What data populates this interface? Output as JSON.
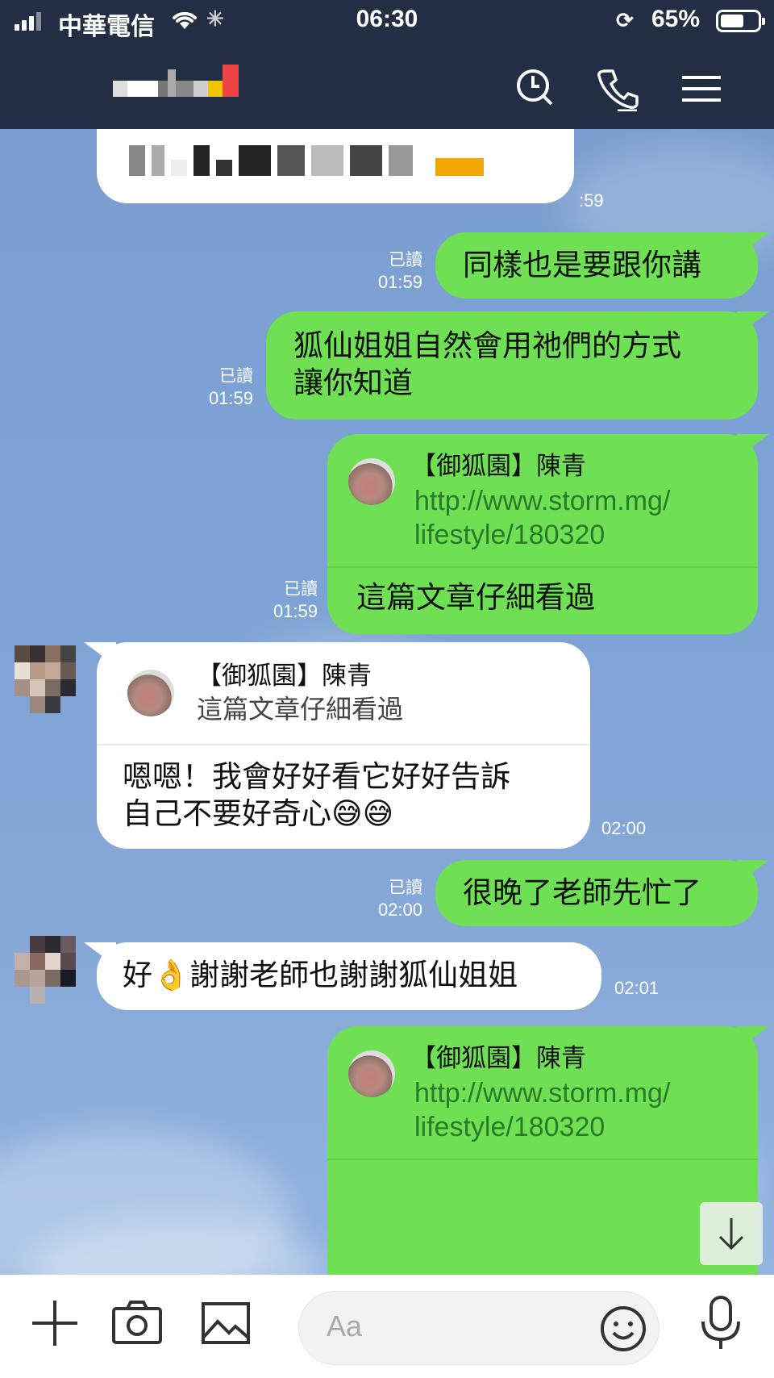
{
  "status_bar": {
    "carrier": "中華電信",
    "time": "06:30",
    "battery": "65%",
    "battery_level": 0.65
  },
  "header": {
    "icons": [
      "search-icon",
      "phone-icon",
      "menu-icon"
    ]
  },
  "messages": [
    {
      "id": "m0",
      "side": "left",
      "text": "",
      "time": ":59"
    },
    {
      "id": "m1",
      "side": "right",
      "read": "已讀",
      "time": "01:59",
      "text": "同樣也是要跟你講"
    },
    {
      "id": "m2",
      "side": "right",
      "read": "已讀",
      "time": "01:59",
      "lines": [
        "狐仙姐姐自然會用祂們的方式",
        "讓你知道"
      ]
    },
    {
      "id": "m3",
      "side": "right",
      "read": "已讀",
      "time": "01:59",
      "preview_title": "【御狐園】陳青",
      "preview_link": [
        "http://www.storm.mg/",
        "lifestyle/180320"
      ],
      "text": "這篇文章仔細看過"
    },
    {
      "id": "m4",
      "side": "left",
      "time": "02:00",
      "quote_title": "【御狐園】陳青",
      "quote_text": "這篇文章仔細看過",
      "lines": [
        "嗯嗯！我會好好看它好好告訴",
        "自己不要好奇心"
      ],
      "emoji": [
        "😅",
        "😅"
      ]
    },
    {
      "id": "m5",
      "side": "right",
      "read": "已讀",
      "time": "02:00",
      "text": "很晚了老師先忙了"
    },
    {
      "id": "m6",
      "side": "left",
      "time": "02:01",
      "text_a": "好",
      "emoji": "👌",
      "text_b": "謝謝老師也謝謝狐仙姐姐"
    },
    {
      "id": "m7",
      "side": "right",
      "preview_title": "【御狐園】陳青",
      "preview_link": [
        "http://www.storm.mg/",
        "lifestyle/180320"
      ]
    }
  ],
  "input": {
    "placeholder": "Aa",
    "icons": [
      "plus-icon",
      "camera-icon",
      "image-icon",
      "emoji-icon",
      "microphone-icon"
    ]
  },
  "colors": {
    "header_bg": "#232d43",
    "chat_bg": "#7d9fcf",
    "bubble_green": "#6fdf54",
    "bubble_white": "#ffffff",
    "link_green": "#2a7a2a"
  }
}
